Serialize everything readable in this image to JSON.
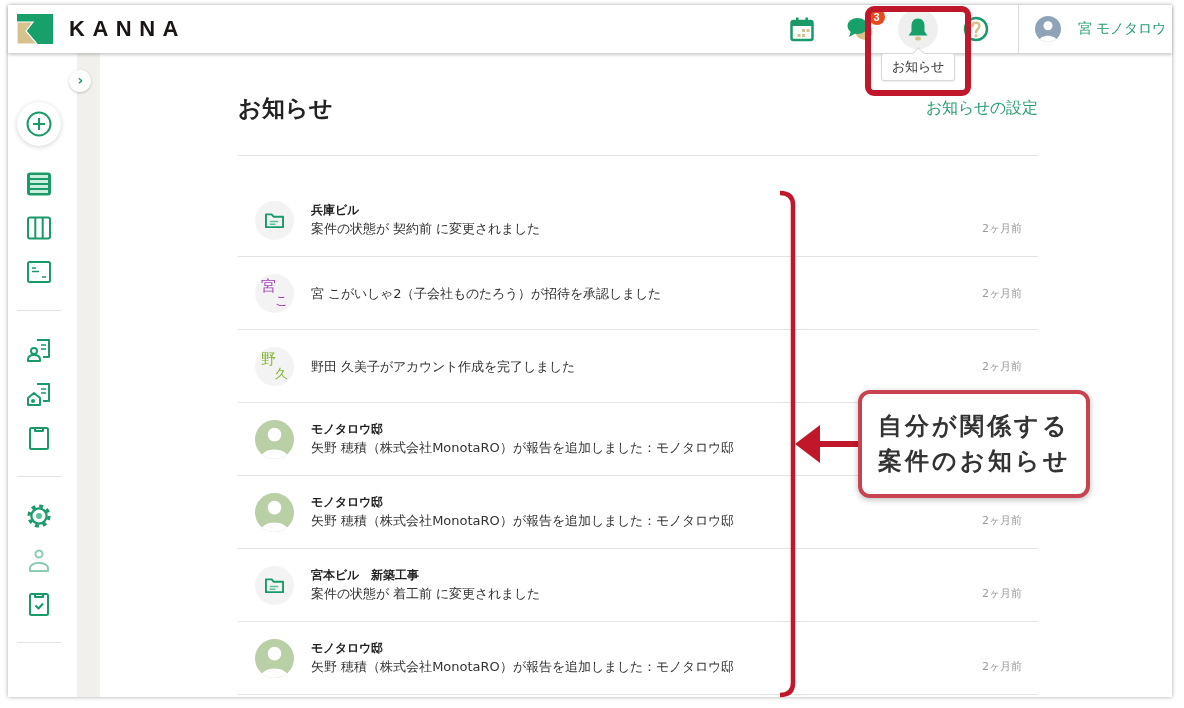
{
  "header": {
    "logo": "KANNA",
    "tools": [
      {
        "kind": "calendar",
        "selected": false
      },
      {
        "kind": "chat",
        "selected": false,
        "badge": "3"
      },
      {
        "kind": "bell",
        "selected": true,
        "tooltip": "お知らせ"
      },
      {
        "kind": "help",
        "selected": false
      }
    ],
    "user": {
      "name": "宮 モノタロウ"
    }
  },
  "sidebar": {
    "toggle": "›",
    "groups": [
      {
        "items": [
          {
            "kind": "list",
            "disabled": false
          },
          {
            "kind": "columns",
            "disabled": false
          },
          {
            "kind": "card",
            "disabled": false
          }
        ]
      },
      {
        "items": [
          {
            "kind": "client",
            "disabled": false
          },
          {
            "kind": "site",
            "disabled": false
          },
          {
            "kind": "clipboard",
            "disabled": false
          }
        ]
      },
      {
        "items": [
          {
            "kind": "settings",
            "disabled": false
          },
          {
            "kind": "person",
            "disabled": true
          },
          {
            "kind": "checklist",
            "disabled": false
          }
        ]
      }
    ]
  },
  "page": {
    "title": "お知らせ",
    "settings_link": "お知らせの設定"
  },
  "notifications": [
    {
      "kind": "project",
      "title": "兵庫ビル",
      "message": "案件の状態が 契約前 に変更されました",
      "time": "2ヶ月前"
    },
    {
      "kind": "user",
      "initials": [
        "宮",
        "こ"
      ],
      "color": "#9c3fb0",
      "message": "宮 こがいしゃ2（子会社ものたろう）が招待を承認しました",
      "time": "2ヶ月前"
    },
    {
      "kind": "user",
      "initials": [
        "野",
        "久"
      ],
      "color": "#7db72f",
      "message": "野田 久美子がアカウント作成を完了しました",
      "time": "2ヶ月前"
    },
    {
      "kind": "photo",
      "title": "モノタロウ邸",
      "message": "矢野 穂積（株式会社MonotaRO）が報告を追加しました：モノタロウ邸"
    },
    {
      "kind": "photo",
      "title": "モノタロウ邸",
      "message": "矢野 穂積（株式会社MonotaRO）が報告を追加しました：モノタロウ邸",
      "time": "2ヶ月前"
    },
    {
      "kind": "project",
      "title": "宮本ビル　新築工事",
      "message": "案件の状態が 着工前 に変更されました",
      "time": "2ヶ月前"
    },
    {
      "kind": "photo",
      "title": "モノタロウ邸",
      "message": "矢野 穂積（株式会社MonotaRO）が報告を追加しました：モノタロウ邸",
      "time": "2ヶ月前"
    }
  ],
  "annotation": {
    "callout_lines": [
      "自分が関係する",
      "案件のお知らせ"
    ]
  }
}
